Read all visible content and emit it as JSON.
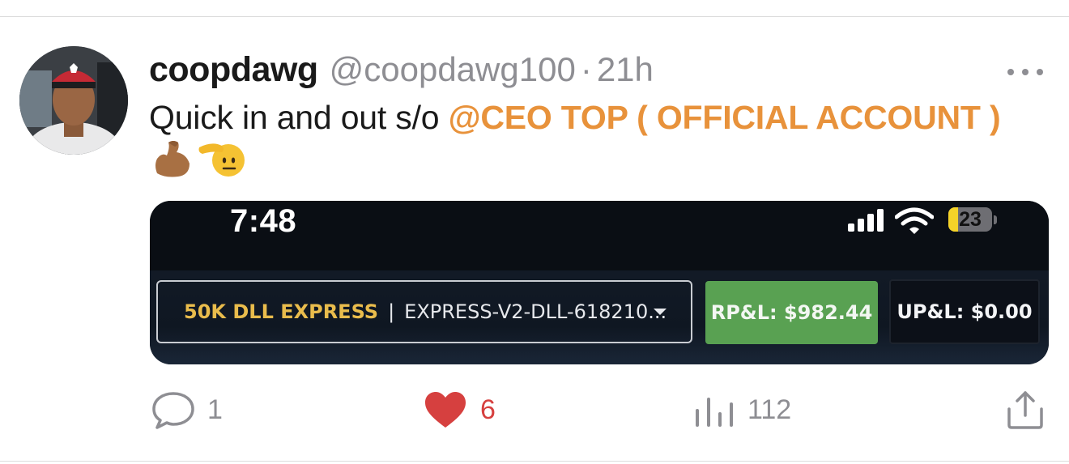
{
  "post": {
    "display_name": "coopdawg",
    "handle": "@coopdawg100",
    "separator": "·",
    "time": "21h",
    "text_prefix": "Quick in and out s/o",
    "mention": "@CEO TOP ( OFFICIAL ACCOUNT )",
    "emojis": [
      "flexed-biceps-emoji",
      "saluting-face-emoji"
    ]
  },
  "embedded_screenshot": {
    "clock": "7:48",
    "battery": "23",
    "account_name": "50K DLL EXPRESS",
    "account_separator": "|",
    "account_id": "EXPRESS-V2-DLL-618210...",
    "rpl": "RP&L: $982.44",
    "upl": "UP&L: $0.00"
  },
  "actions": {
    "replies": "1",
    "likes": "6",
    "views": "112"
  },
  "colors": {
    "mention": "#e8923b",
    "like": "#d6403f",
    "muted": "#8e8e93",
    "account_name": "#e9bc4c",
    "rpl_bg": "#59a152"
  }
}
